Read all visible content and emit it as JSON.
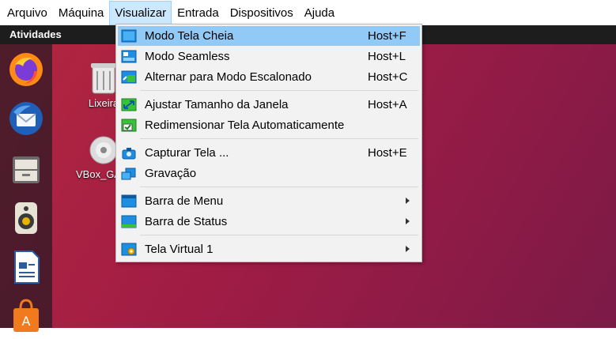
{
  "menubar": {
    "items": [
      "Arquivo",
      "Máquina",
      "Visualizar",
      "Entrada",
      "Dispositivos",
      "Ajuda"
    ],
    "active": "Visualizar"
  },
  "desktop": {
    "activities": "Atividades",
    "dock_icons": [
      "firefox-icon",
      "thunderbird-icon",
      "files-icon",
      "rhythmbox-icon",
      "writer-icon",
      "software-icon"
    ],
    "icons": [
      {
        "label": "Lixeira",
        "icon": "trash-icon"
      },
      {
        "label": "VBox_GAs_6.1.3",
        "icon": "cd-icon"
      }
    ]
  },
  "view_menu": {
    "items": [
      {
        "label": "Modo Tela Cheia",
        "shortcut": "Host+F",
        "icon": "fullscreen-icon",
        "highlighted": true
      },
      {
        "label": "Modo Seamless",
        "shortcut": "Host+L",
        "icon": "seamless-icon"
      },
      {
        "label": "Alternar para Modo Escalonado",
        "shortcut": "Host+C",
        "icon": "scaled-mode-icon"
      },
      {
        "label": "Ajustar Tamanho da Janela",
        "shortcut": "Host+A",
        "icon": "adjust-window-icon"
      },
      {
        "label": "Redimensionar Tela Automaticamente",
        "shortcut": "",
        "icon": "auto-resize-icon"
      },
      {
        "label": "Capturar Tela ...",
        "shortcut": "Host+E",
        "icon": "screenshot-icon"
      },
      {
        "label": "Gravação",
        "shortcut": "",
        "icon": "recording-icon"
      },
      {
        "label": "Barra de Menu",
        "shortcut": "",
        "icon": "menubar-icon",
        "submenu": true
      },
      {
        "label": "Barra de Status",
        "shortcut": "",
        "icon": "statusbar-icon",
        "submenu": true
      },
      {
        "label": "Tela Virtual 1",
        "shortcut": "",
        "icon": "virtual-screen-icon",
        "submenu": true
      }
    ]
  },
  "colors": {
    "highlight": "#91c9f7",
    "active_menubar": "#cce8ff",
    "desktop": "#a01c45"
  }
}
